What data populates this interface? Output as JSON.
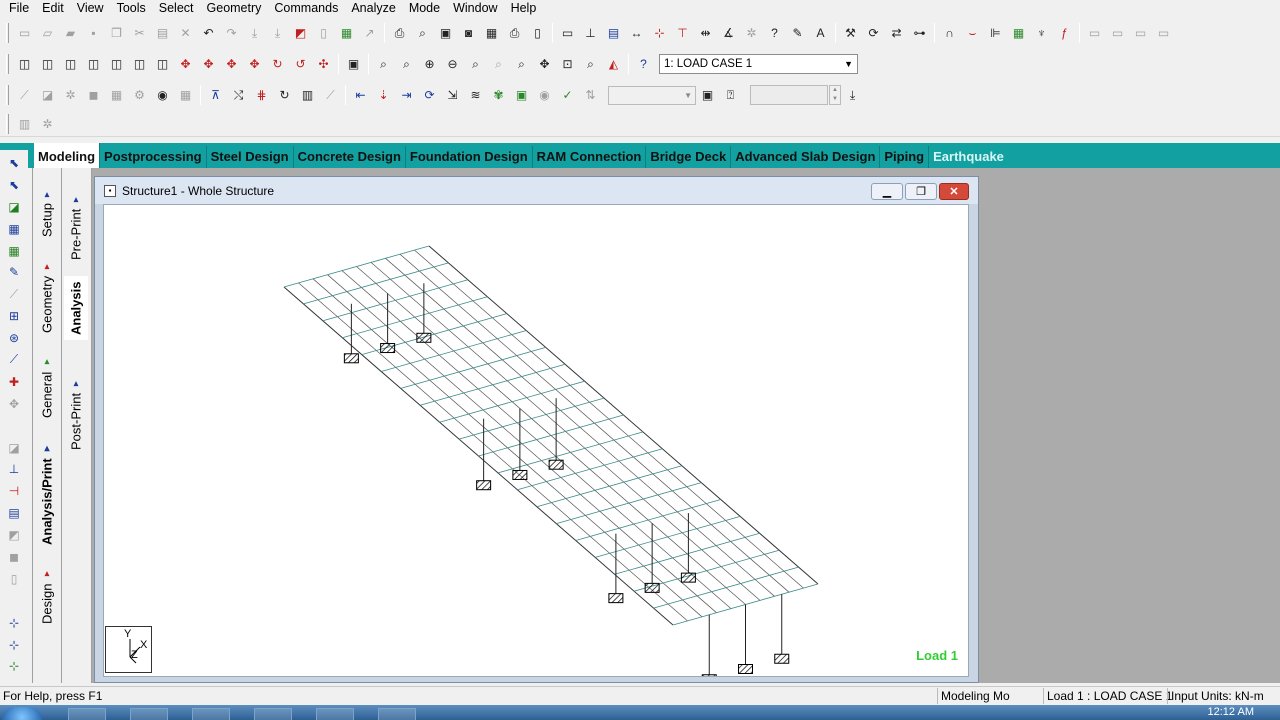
{
  "menu": [
    "File",
    "Edit",
    "View",
    "Tools",
    "Select",
    "Geometry",
    "Commands",
    "Analyze",
    "Mode",
    "Window",
    "Help"
  ],
  "toolbar": {
    "load_case_selected": "1: LOAD CASE 1"
  },
  "tabs": [
    "Modeling",
    "Postprocessing",
    "Steel Design",
    "Concrete Design",
    "Foundation Design",
    "RAM Connection",
    "Bridge Deck",
    "Advanced Slab Design",
    "Piping",
    "Earthquake"
  ],
  "vertical_tabs": {
    "setup": "Setup",
    "geometry": "Geometry",
    "general": "General",
    "analysis_print": "Analysis/Print",
    "design": "Design",
    "pre_print": "Pre-Print",
    "analysis": "Analysis",
    "post_print": "Post-Print"
  },
  "document": {
    "title": "Structure1 - Whole Structure",
    "load_label": "Load 1",
    "axis_y": "Y",
    "axis_x": "X",
    "axis_z": "Z"
  },
  "status": {
    "help": "For Help, press F1",
    "mode": "Modeling Mo",
    "load": "Load 1 : LOAD CASE 1",
    "units": "Input Units:  kN-m"
  },
  "taskbar": {
    "clock": "12:12 AM"
  }
}
